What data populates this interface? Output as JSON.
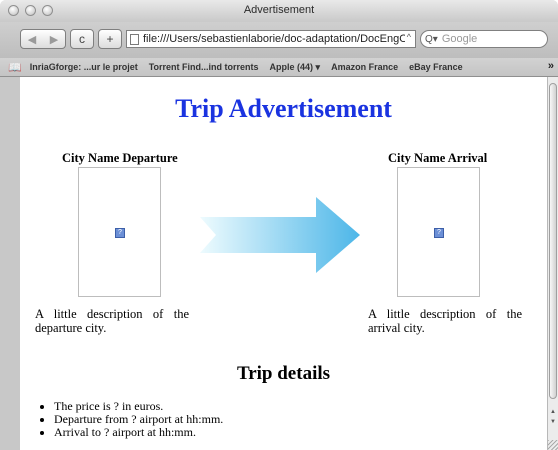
{
  "window": {
    "title": "Advertisement"
  },
  "toolbar": {
    "back_glyph": "◀",
    "forward_glyph": "▶",
    "reload_glyph": "c",
    "add_bookmark_glyph": "+",
    "url": "file:///Users/sebastienlaborie/doc-adaptation/DocEngO",
    "rss_glyph": "^",
    "search_placeholder": "Google",
    "search_glyph": "Q▾"
  },
  "bookmarks": {
    "items": [
      "InriaGforge: ...ur le projet",
      "Torrent Find...ind torrents",
      "Apple (44) ▾",
      "Amazon France",
      "eBay France"
    ],
    "overflow": "»"
  },
  "page": {
    "title": "Trip Advertisement",
    "departure": {
      "heading": "City Name Departure",
      "image_alt": "?",
      "description": "A little description of the departure city."
    },
    "arrival": {
      "heading": "City Name Arrival",
      "image_alt": "?",
      "description": "A little description of the arrival city."
    },
    "details": {
      "heading": "Trip details",
      "items": [
        "The price is ? in euros.",
        "Departure from ? airport at hh:mm.",
        "Arrival to ? airport at hh:mm."
      ]
    }
  },
  "colors": {
    "title_blue": "#1a33e0",
    "arrow_light": "#e8f9fd",
    "arrow_dark": "#4db8ea"
  },
  "icons": {
    "bookmarks_icon": "book-icon",
    "broken_image_icon": "broken-image-icon",
    "arrow": "right-arrow-graphic"
  }
}
